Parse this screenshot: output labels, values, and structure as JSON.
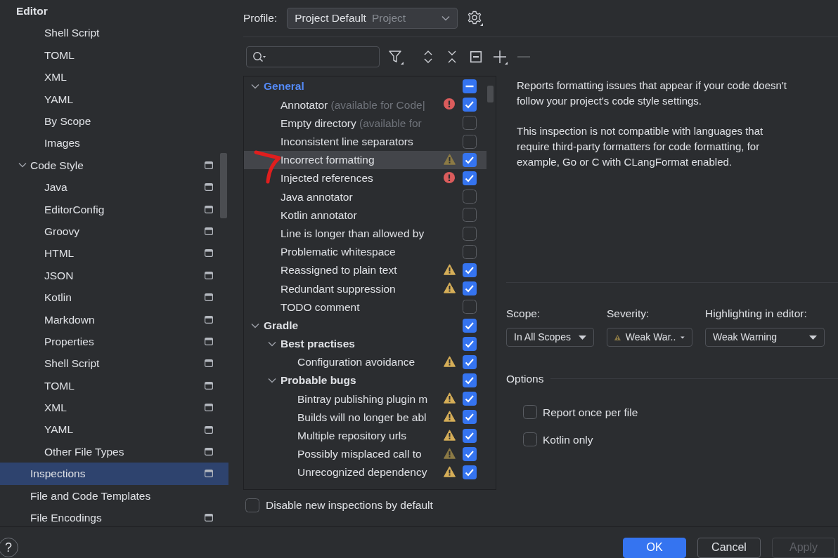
{
  "sidebar": {
    "items": [
      {
        "label": "Editor",
        "selected": false,
        "project_icon": false,
        "children": [
          {
            "children": [
              {
                "label": "Shell Script",
                "selected": false,
                "project_icon": false
              },
              {
                "label": "TOML",
                "selected": false,
                "project_icon": false
              },
              {
                "label": "XML",
                "selected": false,
                "project_icon": false
              },
              {
                "label": "YAML",
                "selected": false,
                "project_icon": false
              },
              {
                "label": "By Scope",
                "selected": false,
                "project_icon": false
              },
              {
                "label": "Images",
                "selected": false,
                "project_icon": false
              }
            ]
          },
          {
            "label": "Code Style",
            "expanded": true,
            "selected": false,
            "project_icon": true,
            "children": [
              {
                "label": "Java",
                "selected": false,
                "project_icon": true
              },
              {
                "label": "EditorConfig",
                "selected": false,
                "project_icon": true
              },
              {
                "label": "Groovy",
                "selected": false,
                "project_icon": true
              },
              {
                "label": "HTML",
                "selected": false,
                "project_icon": true
              },
              {
                "label": "JSON",
                "selected": false,
                "project_icon": true
              },
              {
                "label": "Kotlin",
                "selected": false,
                "project_icon": true
              },
              {
                "label": "Markdown",
                "selected": false,
                "project_icon": true
              },
              {
                "label": "Properties",
                "selected": false,
                "project_icon": true
              },
              {
                "label": "Shell Script",
                "selected": false,
                "project_icon": true
              },
              {
                "label": "TOML",
                "selected": false,
                "project_icon": true
              },
              {
                "label": "XML",
                "selected": false,
                "project_icon": true
              },
              {
                "label": "YAML",
                "selected": false,
                "project_icon": true
              },
              {
                "label": "Other File Types",
                "selected": false,
                "project_icon": true
              }
            ]
          },
          {
            "label": "Inspections",
            "selected": true,
            "project_icon": true
          },
          {
            "label": "File and Code Templates",
            "selected": false,
            "project_icon": false
          },
          {
            "label": "File Encodings",
            "selected": false,
            "project_icon": true
          }
        ]
      }
    ]
  },
  "profile": {
    "label": "Profile:",
    "value": "Project Default",
    "scope": "Project"
  },
  "toolbar": [
    {
      "kind": "filter",
      "disabled": false
    },
    {
      "kind": "expand",
      "disabled": false
    },
    {
      "kind": "collapse",
      "disabled": false
    },
    {
      "kind": "reset",
      "disabled": false
    },
    {
      "kind": "add",
      "disabled": false
    },
    {
      "kind": "remove",
      "disabled": true
    }
  ],
  "tree": [
    {
      "kind": "group",
      "label": "General",
      "expanded": true,
      "modified": true,
      "partial": true,
      "selected": false,
      "children": [
        {
          "kind": "error",
          "label": "Annotator",
          "hint": "(available for Code|",
          "checked": true,
          "selected": false,
          "modified": false
        },
        {
          "kind": "plain",
          "label": "Empty directory",
          "hint": "(available for",
          "checked": false,
          "selected": false,
          "modified": false
        },
        {
          "kind": "plain",
          "label": "Inconsistent line separators",
          "checked": false,
          "selected": false,
          "modified": false
        },
        {
          "kind": "weak_warning",
          "label": "Incorrect formatting",
          "checked": true,
          "selected": true,
          "modified": false
        },
        {
          "kind": "error",
          "label": "Injected references",
          "checked": true,
          "selected": false,
          "modified": false
        },
        {
          "kind": "plain",
          "label": "Java annotator",
          "checked": false,
          "selected": false,
          "modified": false
        },
        {
          "kind": "plain",
          "label": "Kotlin annotator",
          "checked": false,
          "selected": false,
          "modified": false
        },
        {
          "kind": "plain",
          "label": "Line is longer than allowed by",
          "checked": false,
          "selected": false,
          "modified": false
        },
        {
          "kind": "plain",
          "label": "Problematic whitespace",
          "checked": false,
          "selected": false,
          "modified": false
        },
        {
          "kind": "warning",
          "label": "Reassigned to plain text",
          "checked": true,
          "selected": false,
          "modified": false
        },
        {
          "kind": "warning",
          "label": "Redundant suppression",
          "checked": true,
          "selected": false,
          "modified": false
        },
        {
          "kind": "plain",
          "label": "TODO comment",
          "checked": false,
          "selected": false,
          "modified": false
        }
      ]
    },
    {
      "kind": "group",
      "label": "Gradle",
      "expanded": true,
      "modified": false,
      "checked": true,
      "selected": false,
      "children": [
        {
          "kind": "group",
          "label": "Best practises",
          "expanded": true,
          "modified": false,
          "checked": true,
          "selected": false,
          "children": [
            {
              "kind": "warning",
              "label": "Configuration avoidance",
              "checked": true,
              "selected": false,
              "modified": false
            }
          ]
        },
        {
          "kind": "group",
          "label": "Probable bugs",
          "expanded": true,
          "modified": false,
          "checked": true,
          "selected": false,
          "children": [
            {
              "kind": "warning",
              "label": "Bintray publishing plugin m",
              "checked": true,
              "selected": false,
              "modified": false
            },
            {
              "kind": "warning",
              "label": "Builds will no longer be abl",
              "checked": true,
              "selected": false,
              "modified": false
            },
            {
              "kind": "warning",
              "label": "Multiple repository urls",
              "checked": true,
              "selected": false,
              "modified": false
            },
            {
              "kind": "weak_warning",
              "label": "Possibly misplaced call to",
              "checked": true,
              "selected": false,
              "modified": false
            },
            {
              "kind": "warning",
              "label": "Unrecognized dependency",
              "checked": true,
              "selected": false,
              "modified": false
            }
          ]
        }
      ]
    }
  ],
  "disable_new": {
    "label": "Disable new inspections by default",
    "checked": false
  },
  "description": [
    "Reports formatting issues that appear if your code doesn't follow your project's code style settings.",
    "This inspection is not compatible with languages that require third-party formatters for code formatting, for example, Go or C with CLangFormat enabled."
  ],
  "settings": [
    {
      "kind": "plain",
      "label": "Scope:",
      "value": "In All Scopes"
    },
    {
      "kind": "weak_warning",
      "label": "Severity:",
      "value": "Weak War.."
    },
    {
      "kind": "plain",
      "label": "Highlighting in editor:",
      "value": "Weak Warning"
    }
  ],
  "options": {
    "title": "Options",
    "items": [
      {
        "label": "Report once per file",
        "checked": false
      },
      {
        "label": "Kotlin only",
        "checked": false
      }
    ]
  },
  "help": "?",
  "buttons": [
    {
      "label": "OK",
      "kind": "primary",
      "disabled": false
    },
    {
      "label": "Cancel",
      "kind": "default",
      "disabled": false
    },
    {
      "label": "Apply",
      "kind": "default",
      "disabled": true
    }
  ]
}
